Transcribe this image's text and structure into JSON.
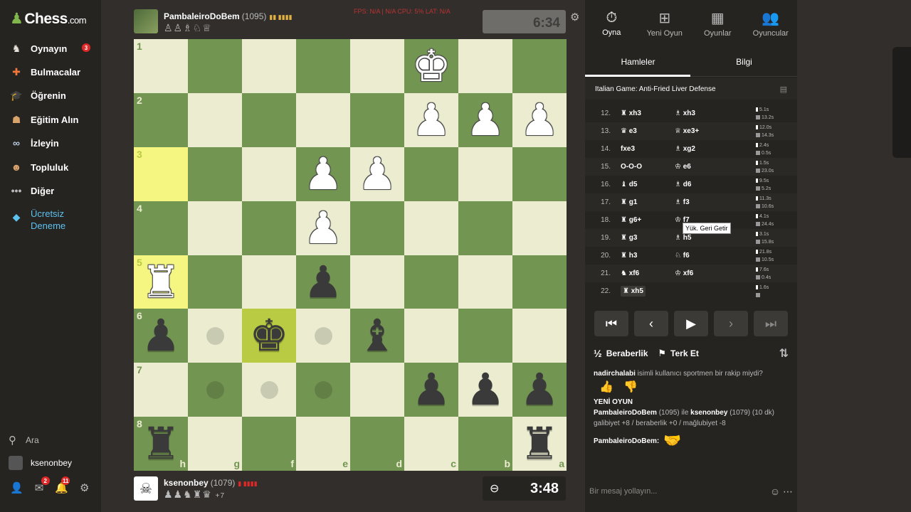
{
  "brand": {
    "name": "Chess",
    "suffix": ".com"
  },
  "sidebar": {
    "items": [
      {
        "label": "Oynayın",
        "icon": "play-icon",
        "badge": "3"
      },
      {
        "label": "Bulmacalar",
        "icon": "puzzle-icon"
      },
      {
        "label": "Öğrenin",
        "icon": "learn-icon"
      },
      {
        "label": "Eğitim Alın",
        "icon": "coach-icon"
      },
      {
        "label": "İzleyin",
        "icon": "watch-icon"
      },
      {
        "label": "Topluluk",
        "icon": "community-icon"
      },
      {
        "label": "Diğer",
        "icon": "more-icon"
      }
    ],
    "trial_line1": "Ücretsiz",
    "trial_line2": "Deneme",
    "search": "Ara",
    "username": "ksenonbey",
    "mail_badge": "2",
    "notif_badge": "11"
  },
  "top_player": {
    "name": "PambaleiroDoBem",
    "rating": "(1095)",
    "time": "6:34",
    "captured": "♙♙♗♘♕"
  },
  "bottom_player": {
    "name": "ksenonbey",
    "rating": "(1079)",
    "time": "3:48",
    "captured": "♟♟♞♜♛",
    "advantage": "+7"
  },
  "perf_overlay": "FPS: N/A  |  N/A   CPU: 5%   LAT: N/A",
  "board": {
    "ranks": [
      "1",
      "2",
      "3",
      "4",
      "5",
      "6",
      "7",
      "8"
    ],
    "files": [
      "h",
      "g",
      "f",
      "e",
      "d",
      "c",
      "b",
      "a"
    ],
    "rows": [
      [
        "",
        "",
        "",
        "",
        "",
        "wK",
        "",
        ""
      ],
      [
        "",
        "",
        "",
        "",
        "",
        "wP",
        "wP",
        "wP"
      ],
      [
        "",
        "",
        "",
        "wP",
        "wP",
        "",
        "",
        ""
      ],
      [
        "",
        "",
        "",
        "wP",
        "",
        "",
        "",
        ""
      ],
      [
        "wR",
        "",
        "",
        "bP",
        "",
        "",
        "",
        ""
      ],
      [
        "bP",
        "dot",
        "bK",
        "dot",
        "bB",
        "",
        "",
        ""
      ],
      [
        "",
        "dot",
        "dot",
        "dot",
        "",
        "bP",
        "bP",
        "bP"
      ],
      [
        "bR",
        "",
        "",
        "",
        "",
        "",
        "",
        "bR"
      ]
    ]
  },
  "panel": {
    "top_tabs": [
      {
        "label": "Oyna",
        "icon": "stopwatch-icon"
      },
      {
        "label": "Yeni Oyun",
        "icon": "plus-icon"
      },
      {
        "label": "Oyunlar",
        "icon": "grid-icon"
      },
      {
        "label": "Oyuncular",
        "icon": "players-icon"
      }
    ],
    "sub_tabs": [
      "Hamleler",
      "Bilgi"
    ],
    "opening": "Italian Game: Anti-Fried Liver Defense",
    "moves": [
      {
        "n": "12.",
        "w": "♜ xh3",
        "b": "♗ xh3",
        "t": [
          "5.1s",
          "13.2s"
        ]
      },
      {
        "n": "13.",
        "w": "♛ e3",
        "b": "♕ xe3+",
        "t": [
          "12.0s",
          "14.3s"
        ]
      },
      {
        "n": "14.",
        "w": "fxe3",
        "b": "♗ xg2",
        "t": [
          "2.4s",
          "0.5s"
        ]
      },
      {
        "n": "15.",
        "w": "O-O-O",
        "b": "♔ e6",
        "t": [
          "1.5s",
          "23.0s"
        ]
      },
      {
        "n": "16.",
        "w": "♝ d5",
        "b": "♗ d6",
        "t": [
          "9.5s",
          "5.2s"
        ]
      },
      {
        "n": "17.",
        "w": "♜ g1",
        "b": "♗ f3",
        "t": [
          "11.3s",
          "10.6s"
        ]
      },
      {
        "n": "18.",
        "w": "♜ g6+",
        "b": "♔ f7",
        "t": [
          "4.1s",
          "24.4s"
        ]
      },
      {
        "n": "19.",
        "w": "♜ g3",
        "b": "♗ h5",
        "t": [
          "3.1s",
          "15.8s"
        ]
      },
      {
        "n": "20.",
        "w": "♜ h3",
        "b": "♘ f6",
        "t": [
          "21.8s",
          "10.5s"
        ]
      },
      {
        "n": "21.",
        "w": "♞ xf6",
        "b": "♔ xf6",
        "t": [
          "7.6s",
          "0.4s"
        ]
      },
      {
        "n": "22.",
        "w": "♜ xh5",
        "b": "",
        "t": [
          "1.6s",
          ""
        ]
      }
    ],
    "tooltip": "Yük. Geri Getir",
    "controls": [
      "⏮",
      "‹",
      "▶",
      "›",
      "⏭"
    ],
    "draw_label": "Beraberlik",
    "draw_icon": "½",
    "resign_label": "Terk Et",
    "chat": {
      "line1_user": "nadirchalabi",
      "line1_text": " isimli kullanıcı sportmen bir rakip miydi?",
      "new_game": "YENİ OYUN",
      "ng_p1": "PambaleiroDoBem",
      "ng_p1r": " (1095) ile ",
      "ng_p2": "ksenonbey",
      "ng_p2r": " (1079) (10 dk)",
      "ng_result": "galibiyet +8 / beraberlik +0 / mağlubiyet -8",
      "last_user": "PambaleiroDoBem:",
      "placeholder": "Bir mesaj yollayın..."
    }
  }
}
